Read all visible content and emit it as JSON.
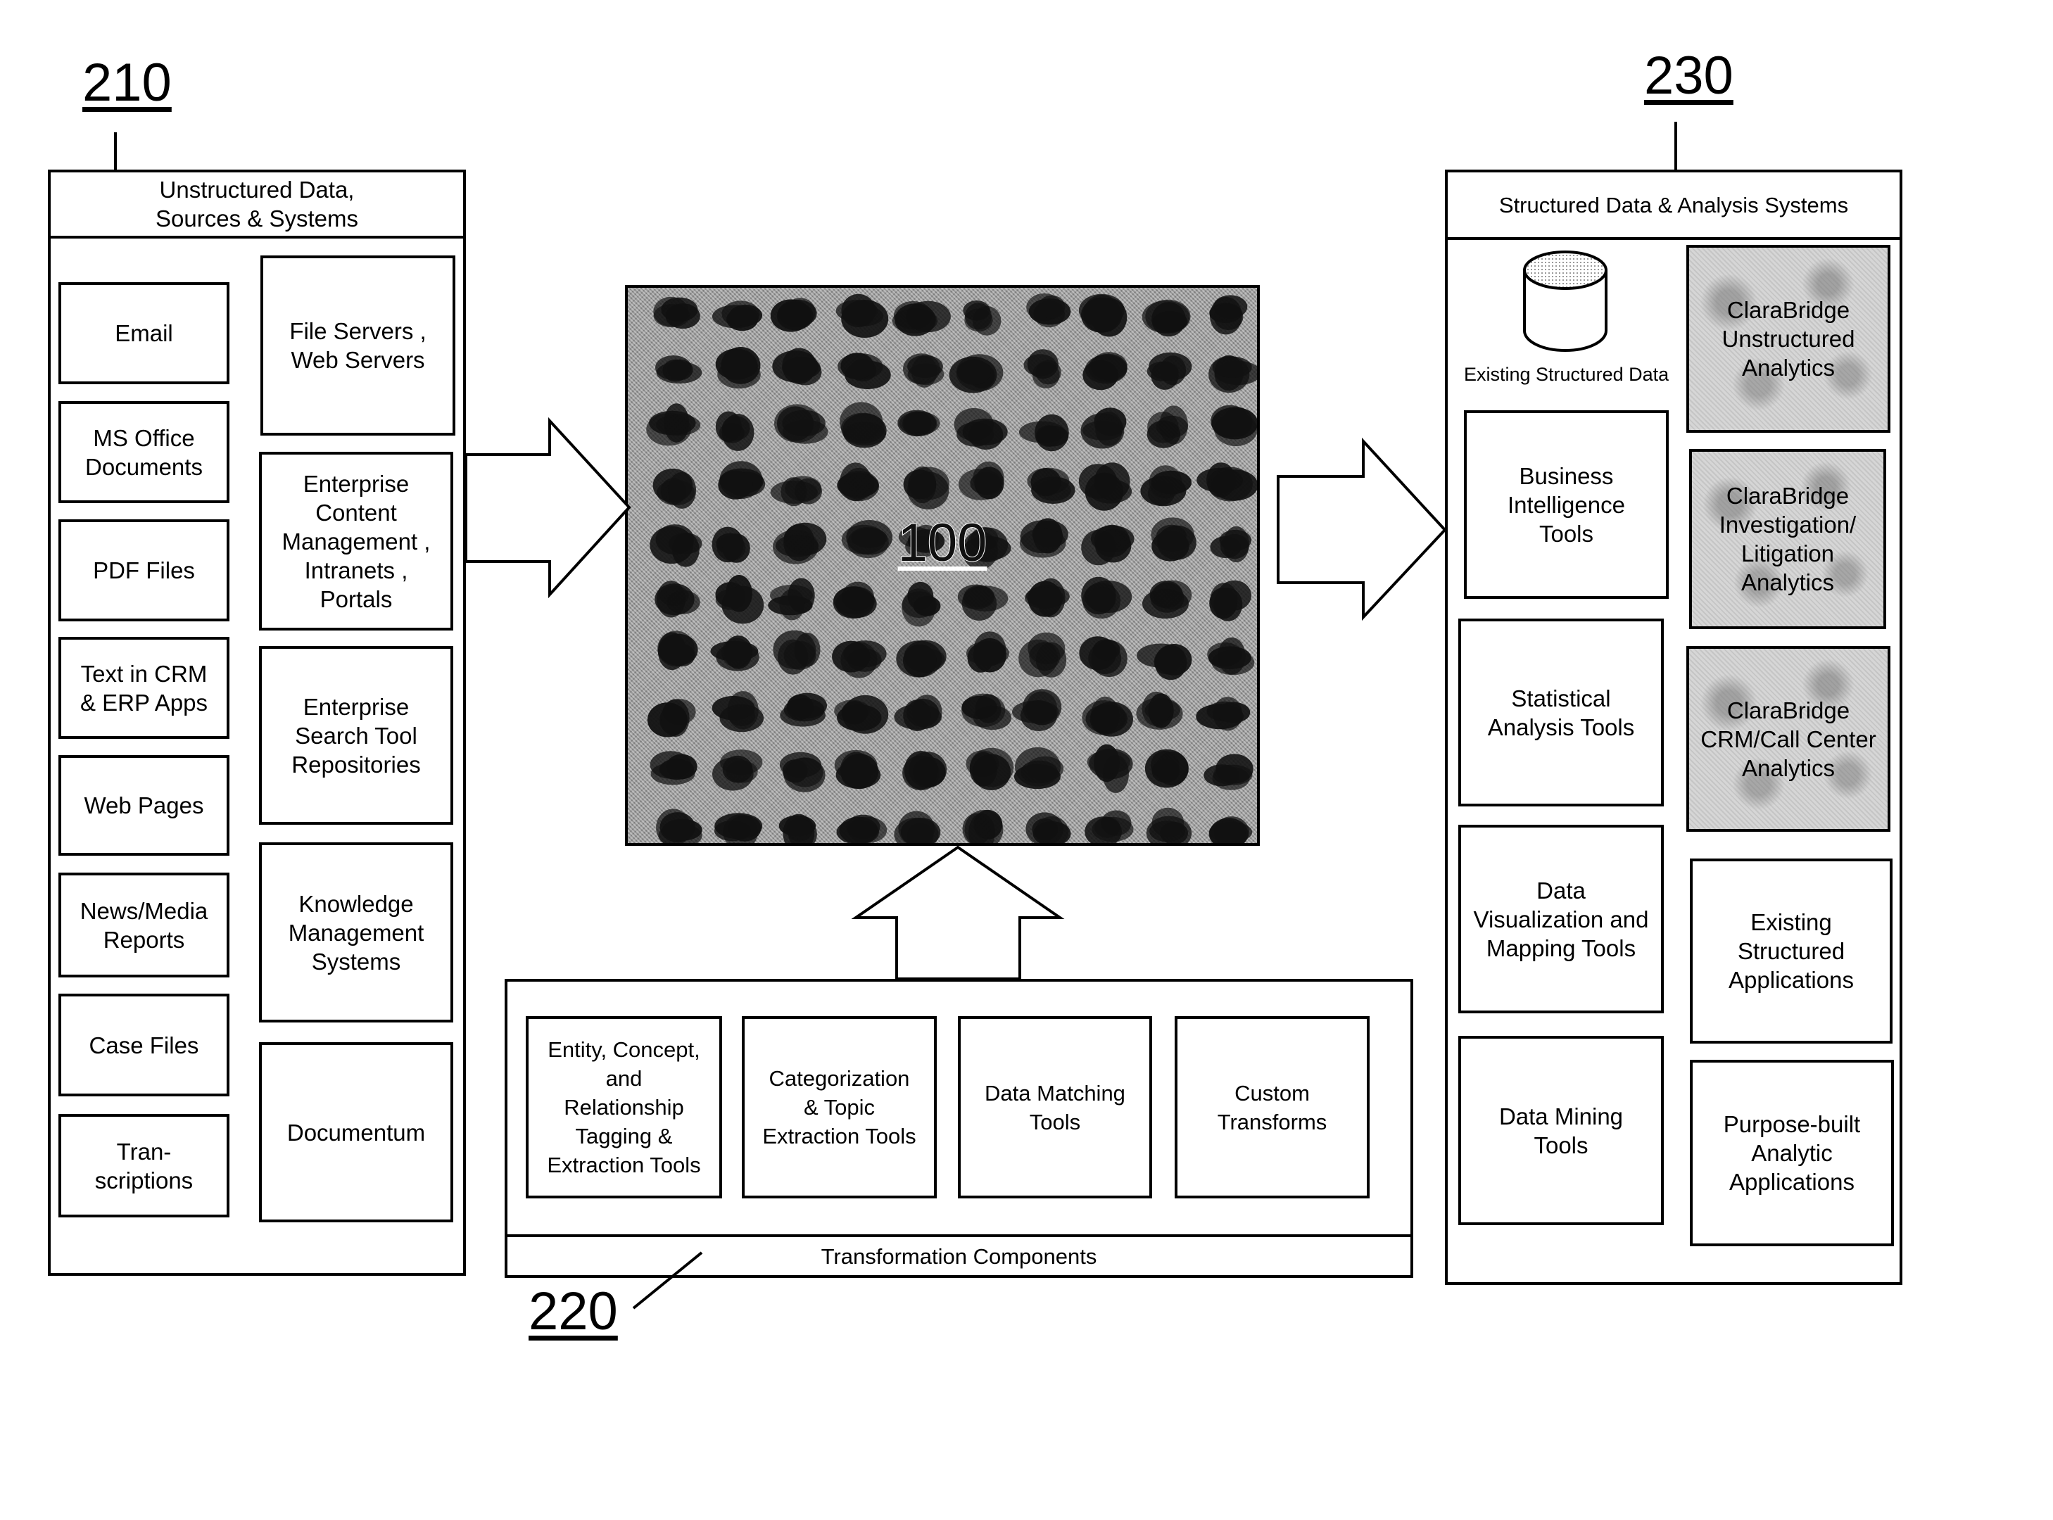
{
  "reference_numerals": {
    "sources": "210",
    "transformation": "220",
    "structured": "230",
    "central_hub": "100"
  },
  "sources_panel": {
    "title": "Unstructured Data,\nSources & Systems",
    "left_column": [
      "Email",
      "MS Office\nDocuments",
      "PDF Files",
      "Text in CRM\n& ERP Apps",
      "Web Pages",
      "News/Media\nReports",
      "Case Files",
      "Tran-\nscriptions"
    ],
    "right_column": [
      "File Servers ,\nWeb Servers",
      "Enterprise\nContent\nManagement ,\nIntranets ,\nPortals",
      "Enterprise\nSearch Tool\nRepositories",
      "Knowledge\nManagement\nSystems",
      "Documentum"
    ]
  },
  "transformation_panel": {
    "title": "Transformation Components",
    "components": [
      "Entity, Concept,\nand\nRelationship\nTagging &\nExtraction Tools",
      "Categorization\n& Topic\nExtraction Tools",
      "Data Matching\nTools",
      "Custom\nTransforms"
    ]
  },
  "structured_panel": {
    "title": "Structured Data & Analysis Systems",
    "database_label": "Existing Structured Data",
    "left_column": [
      "Business\nIntelligence\nTools",
      "Statistical\nAnalysis Tools",
      "Data\nVisualization and\nMapping Tools",
      "Data Mining\nTools"
    ],
    "right_column_highlighted": [
      "ClaraBridge\nUnstructured\nAnalytics",
      "ClaraBridge\nInvestigation/\nLitigation\nAnalytics",
      "ClaraBridge\nCRM/Call Center\nAnalytics"
    ],
    "right_column": [
      "Existing\nStructured\nApplications",
      "Purpose-built\nAnalytic\nApplications"
    ]
  },
  "flow": [
    {
      "from": "sources_panel",
      "to": "central_hub",
      "icon": "arrow-right-icon"
    },
    {
      "from": "transformation_panel",
      "to": "central_hub",
      "icon": "arrow-up-icon"
    },
    {
      "from": "central_hub",
      "to": "structured_panel",
      "icon": "arrow-right-icon"
    }
  ]
}
